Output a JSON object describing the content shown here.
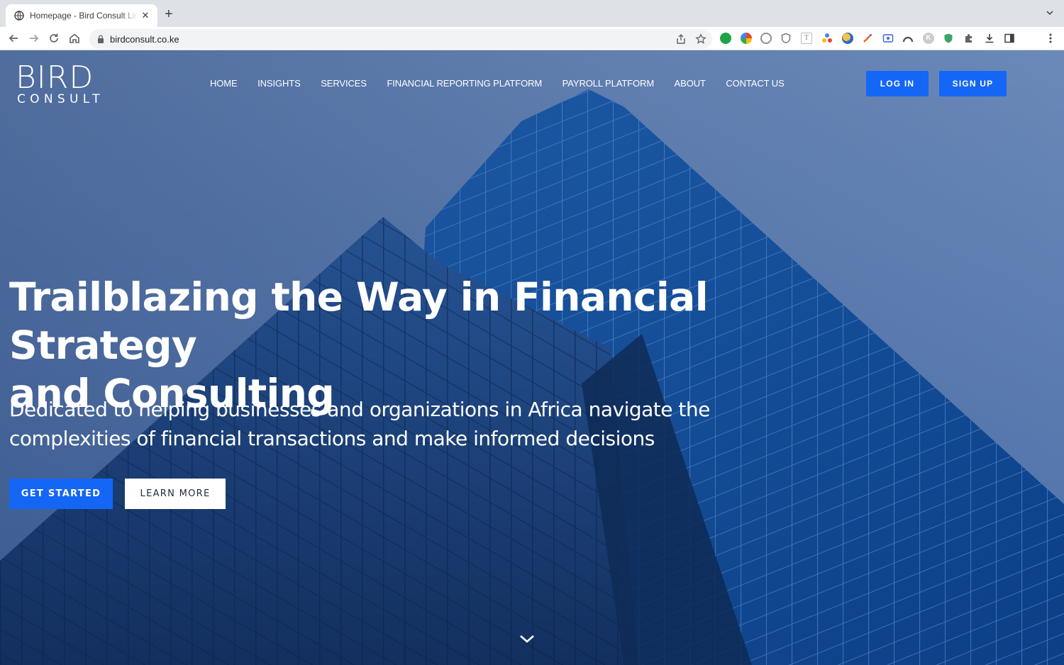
{
  "browser": {
    "tab_title": "Homepage - Bird Consult Limited",
    "close_glyph": "✕",
    "new_tab_glyph": "+",
    "url": "birdconsult.co.ke"
  },
  "site": {
    "logo": {
      "line1": "BIRD",
      "line2": "CONSULT"
    },
    "nav": [
      {
        "label": "HOME"
      },
      {
        "label": "INSIGHTS"
      },
      {
        "label": "SERVICES"
      },
      {
        "label": "FINANCIAL REPORTING PLATFORM"
      },
      {
        "label": "PAYROLL PLATFORM"
      },
      {
        "label": "ABOUT"
      },
      {
        "label": "CONTACT US"
      }
    ],
    "login_label": "LOG IN",
    "signup_label": "SIGN UP"
  },
  "hero": {
    "headline_line1": "Trailblazing the Way in Financial Strategy",
    "headline_line2": "and Consulting",
    "subline_line1": "Dedicated to helping businesses and organizations in Africa navigate the",
    "subline_line2": "complexities of financial transactions and make informed decisions",
    "primary_cta": "GET STARTED",
    "secondary_cta": "LEARN MORE"
  },
  "colors": {
    "accent": "#1466f5",
    "hero_blue": "#3a609e"
  },
  "icons": {
    "tab_favicon": "globe-icon",
    "back": "back-arrow-icon",
    "forward": "forward-arrow-icon",
    "reload": "reload-icon",
    "home": "home-icon",
    "lock": "lock-icon",
    "share": "share-icon",
    "bookmark": "star-icon",
    "scroll": "chevron-down-icon"
  }
}
